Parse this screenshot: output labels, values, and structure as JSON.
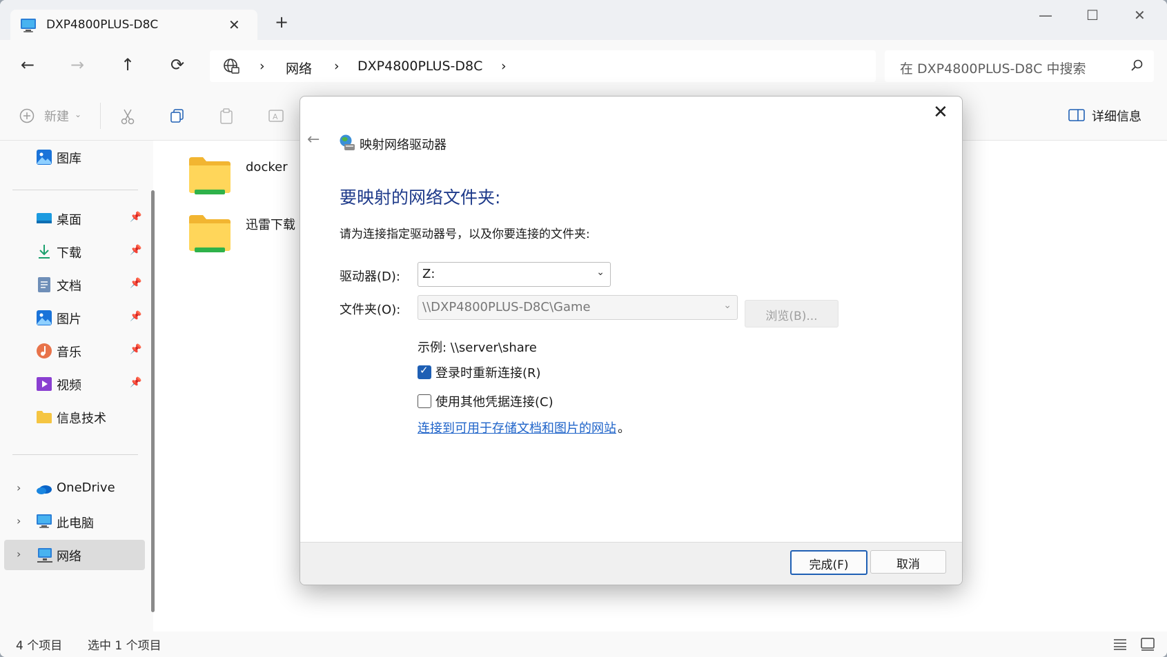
{
  "window": {
    "tab_title": "DXP4800PLUS-D8C",
    "new_tab": "+",
    "minimize": "—",
    "maximize": "☐",
    "close": "✕"
  },
  "nav": {
    "back": "←",
    "forward": "→",
    "up": "↑",
    "refresh": "⟳",
    "breadcrumb": [
      "网络",
      "DXP4800PLUS-D8C"
    ],
    "separator": "›",
    "search_placeholder": "在 DXP4800PLUS-D8C 中搜索"
  },
  "toolbar": {
    "new_label": "新建",
    "details_label": "详细信息"
  },
  "sidebar": {
    "gallery": "图库",
    "quick_access": [
      {
        "label": "桌面",
        "icon": "desktop-icon",
        "pinned": true
      },
      {
        "label": "下载",
        "icon": "download-icon",
        "pinned": true
      },
      {
        "label": "文档",
        "icon": "document-icon",
        "pinned": true
      },
      {
        "label": "图片",
        "icon": "pictures-icon",
        "pinned": true
      },
      {
        "label": "音乐",
        "icon": "music-icon",
        "pinned": true
      },
      {
        "label": "视频",
        "icon": "video-icon",
        "pinned": true
      },
      {
        "label": "信息技术",
        "icon": "folder-icon",
        "pinned": false
      }
    ],
    "locations": [
      {
        "label": "OneDrive",
        "icon": "onedrive-icon"
      },
      {
        "label": "此电脑",
        "icon": "computer-icon"
      },
      {
        "label": "网络",
        "icon": "network-icon",
        "selected": true
      }
    ],
    "pin_glyph": "📌",
    "chevron": "›"
  },
  "content": {
    "folders": [
      "docker",
      "迅雷下载"
    ]
  },
  "status": {
    "item_count": "4 个项目",
    "selected": "选中 1 个项目"
  },
  "dialog": {
    "title": "映射网络驱动器",
    "heading": "要映射的网络文件夹:",
    "description": "请为连接指定驱动器号，以及你要连接的文件夹:",
    "drive_label": "驱动器(D):",
    "drive_value": "Z:",
    "folder_label": "文件夹(O):",
    "folder_value": "\\\\DXP4800PLUS-D8C\\Game",
    "browse_label": "浏览(B)...",
    "example": "示例: \\\\server\\share",
    "reconnect_label": "登录时重新连接(R)",
    "reconnect_checked": true,
    "other_creds_label": "使用其他凭据连接(C)",
    "other_creds_checked": false,
    "link_text": "连接到可用于存储文档和图片的网站",
    "link_suffix": "。",
    "finish_label": "完成(F)",
    "cancel_label": "取消",
    "close_glyph": "✕",
    "back_glyph": "←"
  },
  "colors": {
    "accent": "#1e5fb4",
    "heading": "#1e3a8a",
    "link": "#1e63c9",
    "folder": "#f5c542"
  }
}
